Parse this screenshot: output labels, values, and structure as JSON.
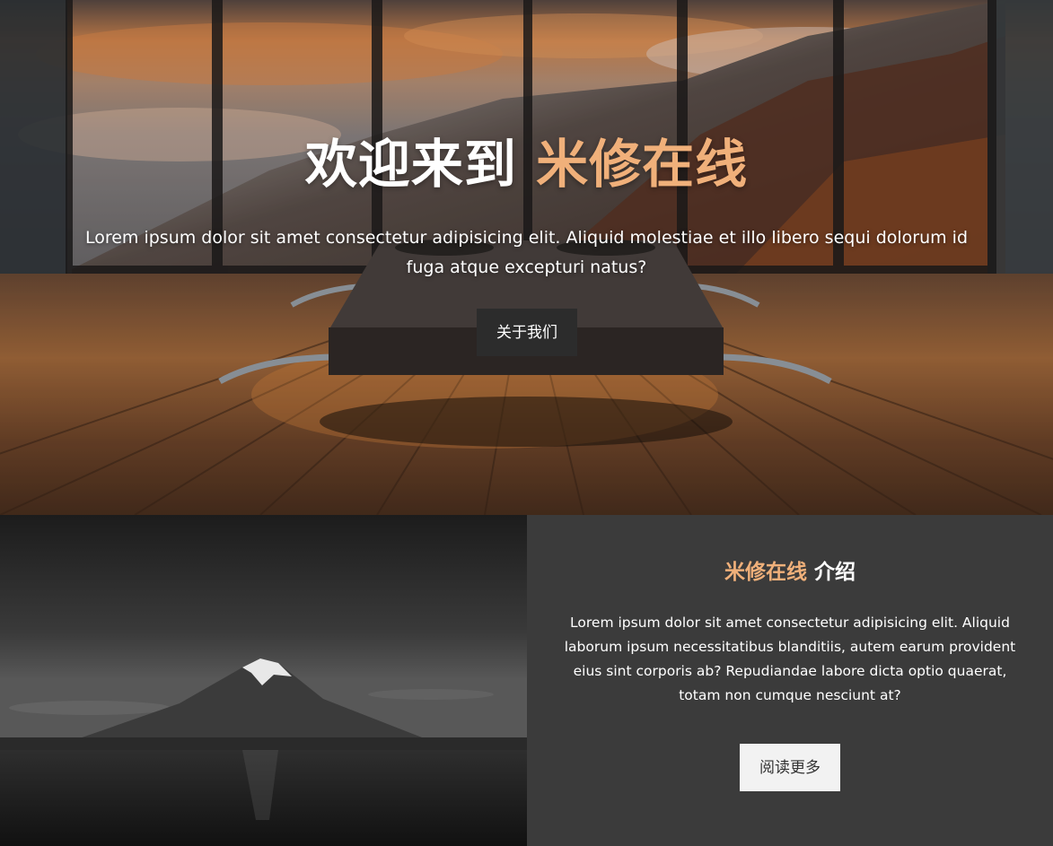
{
  "hero": {
    "title_main": "欢迎来到 ",
    "title_accent": "米修在线",
    "text": "Lorem ipsum dolor sit amet consectetur adipisicing elit. Aliquid molestiae et illo libero sequi dolorum id fuga atque excepturi natus?",
    "button_label": "关于我们"
  },
  "about": {
    "title_accent": "米修在线",
    "title_main": " 介绍",
    "text": "Lorem ipsum dolor sit amet consectetur adipisicing elit. Aliquid laborum ipsum necessitatibus blanditiis, autem earum provident eius sint corporis ab? Repudiandae labore dicta optio quaerat, totam non cumque nesciunt at?",
    "button_label": "阅读更多"
  },
  "colors": {
    "accent": "#f0b07a",
    "hero_button_bg": "#2c2c2c",
    "about_panel_bg": "#3b3b3b",
    "about_button_bg": "#f2f2f2"
  },
  "images": {
    "hero_background": "bedroom-with-mountain-view-image",
    "about_image": "mountain-lake-grayscale-image"
  }
}
